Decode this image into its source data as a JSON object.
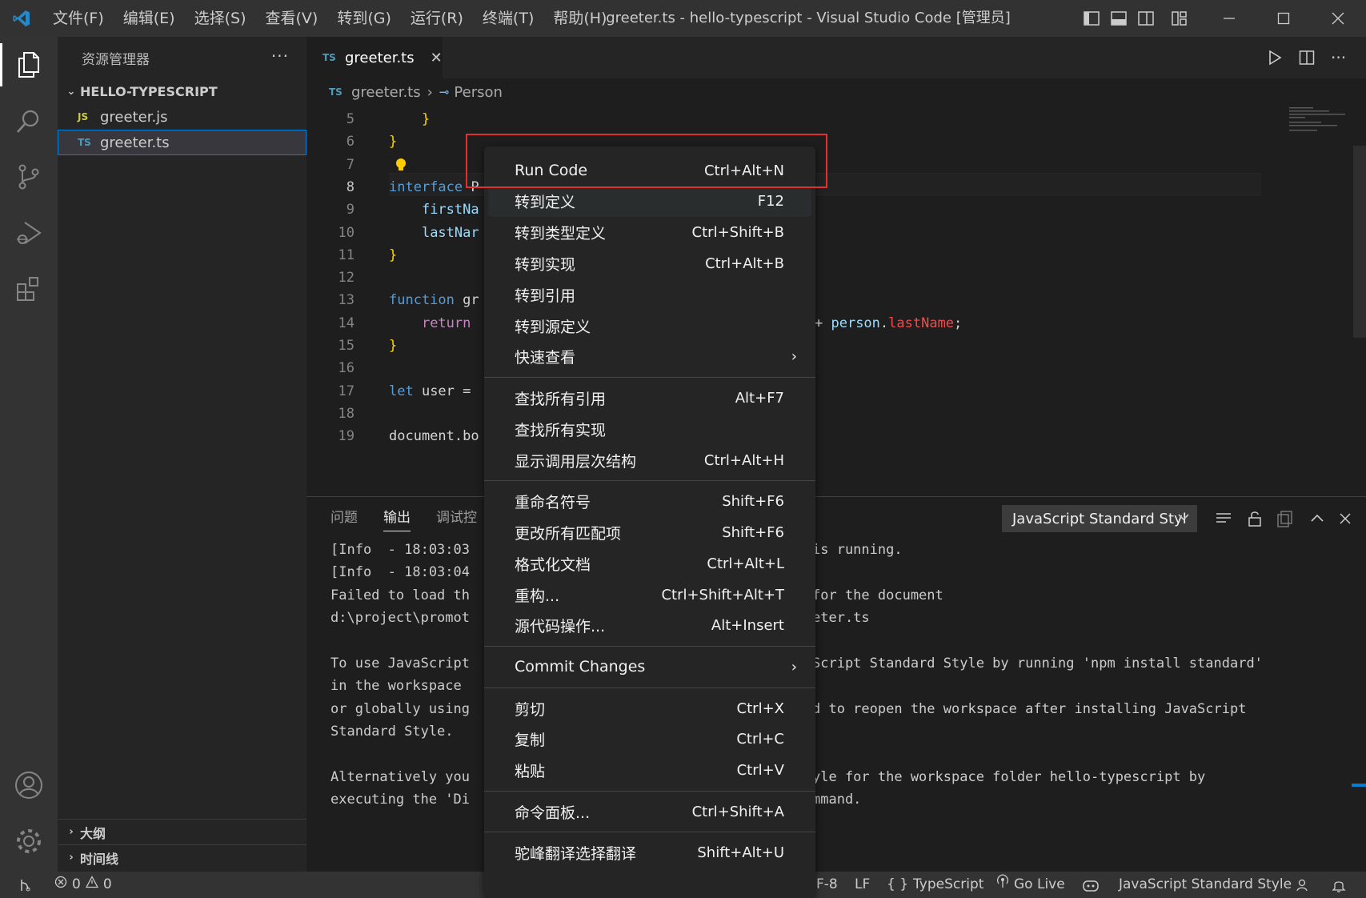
{
  "window": {
    "menu": [
      "文件(F)",
      "编辑(E)",
      "选择(S)",
      "查看(V)",
      "转到(G)",
      "运行(R)",
      "终端(T)",
      "帮助(H)"
    ],
    "title": "greeter.ts - hello-typescript - Visual Studio Code [管理员]"
  },
  "sidebar": {
    "title": "资源管理器",
    "more": "···",
    "folder": "HELLO-TYPESCRIPT",
    "files": [
      {
        "icon": "JS",
        "name": "greeter.js"
      },
      {
        "icon": "TS",
        "name": "greeter.ts"
      }
    ],
    "outline": "大纲",
    "timeline": "时间线"
  },
  "editor": {
    "tab_icon": "TS",
    "tab_name": "greeter.ts",
    "tab_close": "✕",
    "breadcrumb_icon": "TS",
    "breadcrumb_file": "greeter.ts",
    "breadcrumb_sep": "›",
    "breadcrumb_symbol": "Person",
    "line_numbers": [
      "5",
      "6",
      "7",
      "8",
      "9",
      "10",
      "11",
      "12",
      "13",
      "14",
      "15",
      "16",
      "17",
      "18",
      "19"
    ],
    "code": {
      "l5": "}",
      "l6": "}",
      "l8_kw": "interface",
      "l8_rest": " P",
      "l9": "firstNa",
      "l10": "lastNar",
      "l11": "}",
      "l13_kw": "function",
      "l13_rest": " gr",
      "l14_kw": "return",
      "l14_tail_op": "+ ",
      "l14_tail_id": "person",
      "l14_tail_dot": ".",
      "l14_tail_prop": "lastName",
      "l14_tail_end": ";",
      "l15": "}",
      "l17_kw": "let",
      "l17_rest": " user =",
      "l19": "document.bo"
    }
  },
  "panel": {
    "tabs": [
      "问题",
      "输出",
      "调试控"
    ],
    "output_channel": "JavaScript Standard Styl",
    "output_lines_left": [
      "[Info  - 18:03:03",
      "[Info  - 18:03:04",
      "Failed to load th",
      "d:\\project\\promot",
      "",
      "To use JavaScript",
      "in the workspace",
      "or globally using",
      "Standard Style.",
      "",
      "Alternatively you",
      "executing the 'Di"
    ],
    "output_lines_right": [
      "is running.",
      "",
      "for the document",
      "eter.ts",
      "",
      "Script Standard Style by running 'npm install standard'",
      "",
      "d to reopen the workspace after installing JavaScript",
      "",
      "",
      "yle for the workspace folder hello-typescript by",
      "mmand."
    ]
  },
  "context_menu": {
    "groups": [
      [
        {
          "label": "Run Code",
          "shortcut": "Ctrl+Alt+N"
        },
        {
          "label": "转到定义",
          "shortcut": "F12"
        },
        {
          "label": "转到类型定义",
          "shortcut": "Ctrl+Shift+B"
        },
        {
          "label": "转到实现",
          "shortcut": "Ctrl+Alt+B"
        },
        {
          "label": "转到引用",
          "shortcut": ""
        },
        {
          "label": "转到源定义",
          "shortcut": ""
        },
        {
          "label": "快速查看",
          "shortcut": "",
          "submenu": true
        }
      ],
      [
        {
          "label": "查找所有引用",
          "shortcut": "Alt+F7"
        },
        {
          "label": "查找所有实现",
          "shortcut": ""
        },
        {
          "label": "显示调用层次结构",
          "shortcut": "Ctrl+Alt+H"
        }
      ],
      [
        {
          "label": "重命名符号",
          "shortcut": "Shift+F6"
        },
        {
          "label": "更改所有匹配项",
          "shortcut": "Shift+F6"
        },
        {
          "label": "格式化文档",
          "shortcut": "Ctrl+Alt+L"
        },
        {
          "label": "重构...",
          "shortcut": "Ctrl+Shift+Alt+T"
        },
        {
          "label": "源代码操作...",
          "shortcut": "Alt+Insert"
        }
      ],
      [
        {
          "label": "Commit Changes",
          "shortcut": "",
          "submenu": true
        }
      ],
      [
        {
          "label": "剪切",
          "shortcut": "Ctrl+X"
        },
        {
          "label": "复制",
          "shortcut": "Ctrl+C"
        },
        {
          "label": "粘贴",
          "shortcut": "Ctrl+V"
        }
      ],
      [
        {
          "label": "命令面板...",
          "shortcut": "Ctrl+Shift+A"
        }
      ],
      [
        {
          "label": "驼峰翻译选择翻译",
          "shortcut": "Shift+Alt+U"
        }
      ]
    ],
    "submenu_glyph": "›"
  },
  "statusbar": {
    "errors": "0",
    "warnings": "0",
    "encoding": "F-8",
    "eol": "LF",
    "language_braces": "{ }",
    "language": "TypeScript",
    "golive": "Go Live",
    "linter": "JavaScript Standard Style"
  },
  "colors": {
    "accent": "#007fd4",
    "highlight_box": "#e03030",
    "keyword": "#c586c0",
    "bracket": "#ffd700"
  }
}
